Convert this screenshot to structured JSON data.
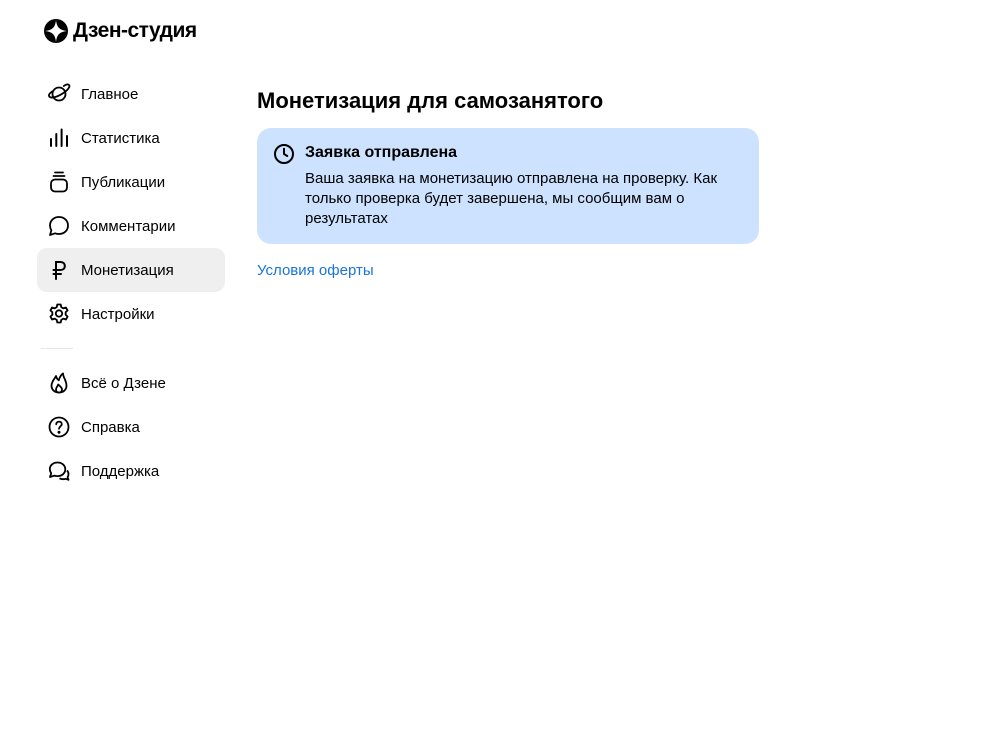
{
  "logo": {
    "text": "Дзен-студия",
    "icon": "zen-logo-icon"
  },
  "sidebar": {
    "primary": [
      {
        "label": "Главное",
        "icon": "planet-icon"
      },
      {
        "label": "Статистика",
        "icon": "bar-chart-icon"
      },
      {
        "label": "Публикации",
        "icon": "publications-icon"
      },
      {
        "label": "Комментарии",
        "icon": "comment-icon"
      },
      {
        "label": "Монетизация",
        "icon": "ruble-icon",
        "active": true
      },
      {
        "label": "Настройки",
        "icon": "gear-icon"
      }
    ],
    "secondary": [
      {
        "label": "Всё о Дзене",
        "icon": "flame-icon"
      },
      {
        "label": "Справка",
        "icon": "help-icon"
      },
      {
        "label": "Поддержка",
        "icon": "support-chat-icon"
      }
    ]
  },
  "main": {
    "title": "Монетизация для самозанятого",
    "notice": {
      "icon": "clock-icon",
      "title": "Заявка отправлена",
      "text": "Ваша заявка на монетизацию отправлена на проверку. Как только проверка будет завершена, мы сообщим вам о результатах"
    },
    "offer_link": "Условия оферты"
  },
  "colors": {
    "accent_link": "#1a73d9",
    "notice_background": "#cde2ff",
    "active_item_background": "#efefef"
  }
}
